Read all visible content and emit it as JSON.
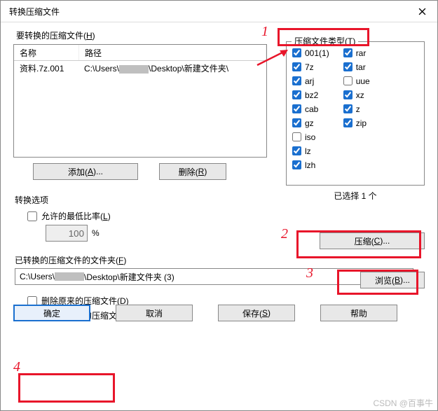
{
  "title": "转换压缩文件",
  "files_label_pre": "要转换的压缩文件(",
  "files_label_key": "H",
  "files_label_post": ")",
  "col_name": "名称",
  "col_path": "路径",
  "row1_name": "资料.7z.001",
  "row1_path_a": "C:\\Users\\",
  "row1_path_b": "\\Desktop\\新建文件夹\\",
  "add_btn_pre": "添加(",
  "add_btn_key": "A",
  "add_btn_post": ")...",
  "remove_btn_pre": "删除(",
  "remove_btn_key": "R",
  "remove_btn_post": ")",
  "types_label_pre": "压缩文件类型(",
  "types_label_key": "T",
  "types_label_post": ")",
  "types": [
    {
      "label": "001(1)",
      "checked": true
    },
    {
      "label": "7z",
      "checked": true
    },
    {
      "label": "arj",
      "checked": true
    },
    {
      "label": "bz2",
      "checked": true
    },
    {
      "label": "cab",
      "checked": true
    },
    {
      "label": "gz",
      "checked": true
    },
    {
      "label": "iso",
      "checked": false
    },
    {
      "label": "lz",
      "checked": true
    },
    {
      "label": "lzh",
      "checked": true
    },
    {
      "label": "rar",
      "checked": true
    },
    {
      "label": "tar",
      "checked": true
    },
    {
      "label": "uue",
      "checked": false
    },
    {
      "label": "xz",
      "checked": true
    },
    {
      "label": "z",
      "checked": true
    },
    {
      "label": "zip",
      "checked": true
    }
  ],
  "selected_count": "已选择 1 个",
  "opt_title": "转换选项",
  "min_ratio_pre": "允许的最低比率(",
  "min_ratio_key": "L",
  "min_ratio_post": ")",
  "min_ratio_val": "100",
  "percent": "%",
  "compress_btn_pre": "压缩(",
  "compress_btn_key": "C",
  "compress_btn_post": ")...",
  "folder_label_pre": "已转换的压缩文件的文件夹(",
  "folder_label_key": "F",
  "folder_label_post": ")",
  "browse_btn_pre": "浏览(",
  "browse_btn_key": "B",
  "browse_btn_post": ")...",
  "folder_val_a": "C:\\Users\\",
  "folder_val_b": "\\Desktop\\新建文件夹 (3)",
  "del_orig_pre": "删除原来的压缩文件(",
  "del_orig_key": "D",
  "del_orig_post": ")",
  "skip_enc_pre": "忽略已加密的压缩文件(",
  "skip_enc_key": "E",
  "skip_enc_post": ")",
  "ok": "确定",
  "cancel": "取消",
  "save_pre": "保存(",
  "save_key": "S",
  "save_post": ")",
  "help": "帮助",
  "num1": "1",
  "num2": "2",
  "num3": "3",
  "num4": "4",
  "watermark": "CSDN @百事牛"
}
